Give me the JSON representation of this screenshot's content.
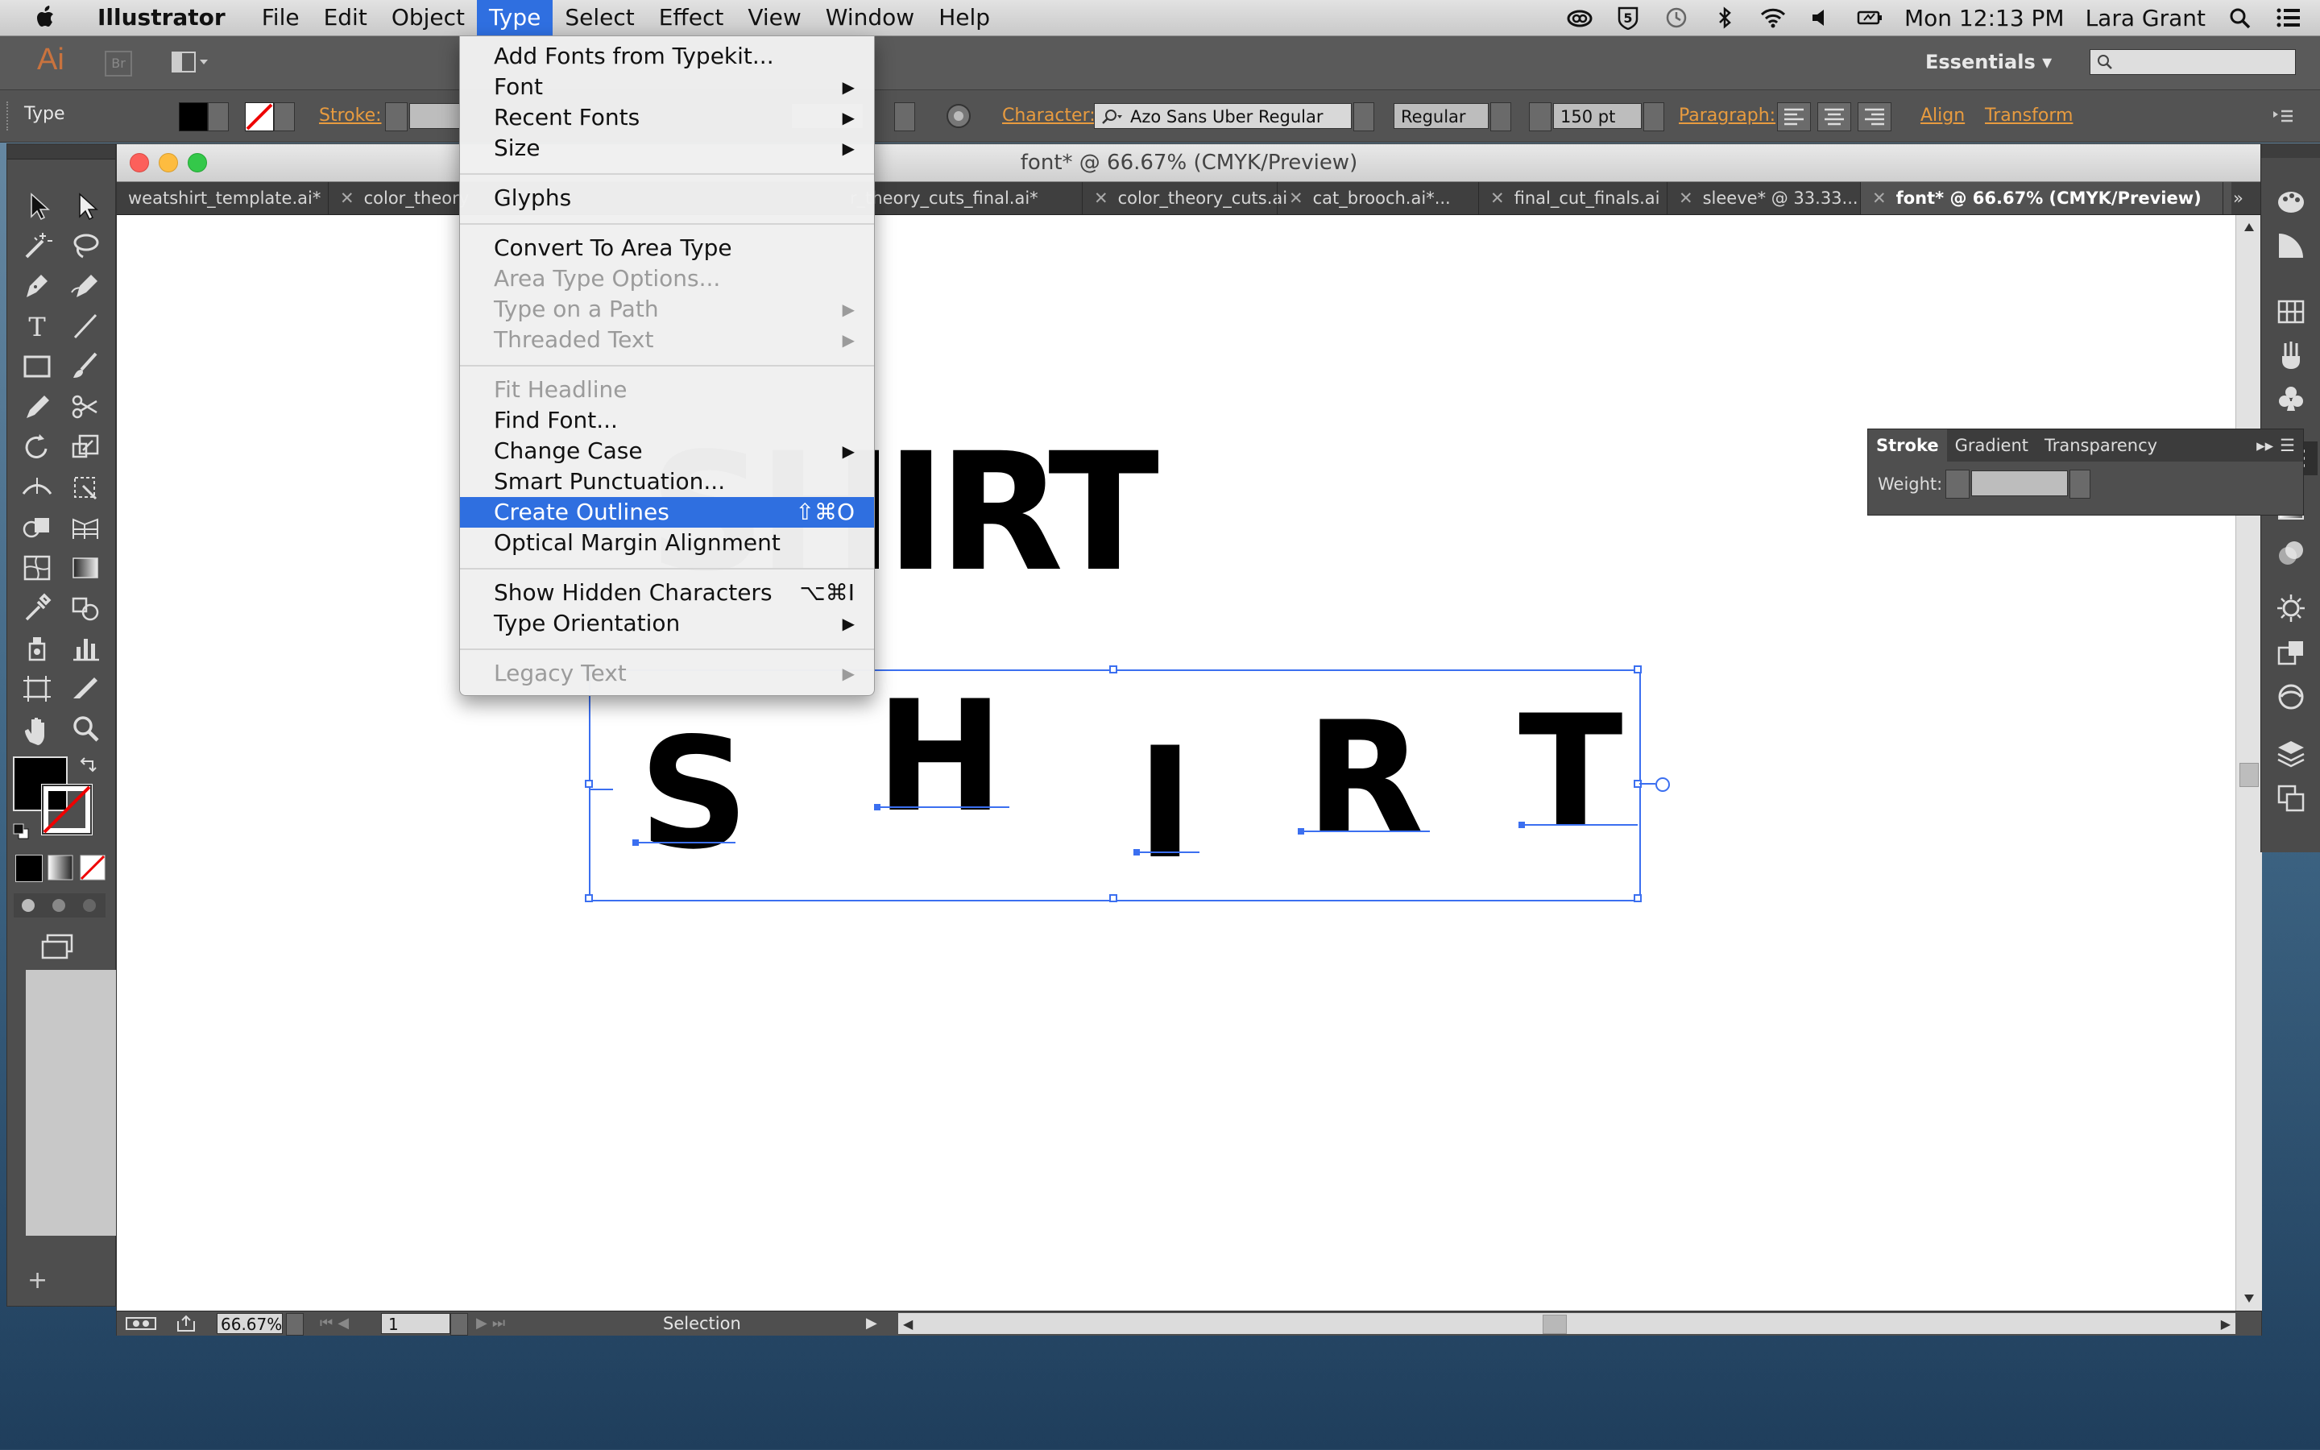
{
  "menubar": {
    "app": "Illustrator",
    "menus": [
      "File",
      "Edit",
      "Object",
      "Type",
      "Select",
      "Effect",
      "View",
      "Window",
      "Help"
    ],
    "active_menu": "Type",
    "clock": "Mon 12:13 PM",
    "user": "Lara Grant"
  },
  "appbar": {
    "logo": "Ai",
    "bridge": "Br",
    "workspace": "Essentials",
    "workspace_arrow": "▾"
  },
  "controlbar": {
    "tool_label": "Type",
    "stroke_label": "Stroke:",
    "character_label": "Character:",
    "font_family": "Azo Sans Uber Regular",
    "font_style": "Regular",
    "font_size": "150 pt",
    "paragraph_label": "Paragraph:",
    "align_label": "Align",
    "transform_label": "Transform"
  },
  "document": {
    "title": "font* @ 66.67% (CMYK/Preview)",
    "tabs": [
      "weatshirt_template.ai*",
      "color_theory",
      "r_theory_cuts_final.ai*",
      "color_theory_cuts.ai",
      "cat_brooch.ai*...",
      "final_cut_finals.ai",
      "sleeve* @ 33.33...",
      "font* @ 66.67% (CMYK/Preview)"
    ],
    "active_tab_index": 7,
    "art_top": "SHIRT",
    "art_letters": [
      "S",
      "H",
      "I",
      "R",
      "T"
    ]
  },
  "statusbar": {
    "zoom": "66.67%",
    "artboard": "1",
    "mode": "Selection"
  },
  "stroke_panel": {
    "tabs": [
      "Stroke",
      "Gradient",
      "Transparency"
    ],
    "active_tab": "Stroke",
    "weight_label": "Weight:"
  },
  "type_menu": {
    "items": [
      {
        "label": "Add Fonts from Typekit...",
        "enabled": true
      },
      {
        "label": "Font",
        "enabled": true,
        "submenu": true
      },
      {
        "label": "Recent Fonts",
        "enabled": true,
        "submenu": true
      },
      {
        "label": "Size",
        "enabled": true,
        "submenu": true
      },
      {
        "label": "Glyphs",
        "enabled": true
      },
      {
        "label": "Convert To Area Type",
        "enabled": true
      },
      {
        "label": "Area Type Options...",
        "enabled": false
      },
      {
        "label": "Type on a Path",
        "enabled": false,
        "submenu": true
      },
      {
        "label": "Threaded Text",
        "enabled": false,
        "submenu": true
      },
      {
        "label": "Fit Headline",
        "enabled": false
      },
      {
        "label": "Find Font...",
        "enabled": true
      },
      {
        "label": "Change Case",
        "enabled": true,
        "submenu": true
      },
      {
        "label": "Smart Punctuation...",
        "enabled": true
      },
      {
        "label": "Create Outlines",
        "enabled": true,
        "shortcut": "⇧⌘O",
        "highlighted": true
      },
      {
        "label": "Optical Margin Alignment",
        "enabled": true
      },
      {
        "label": "Show Hidden Characters",
        "enabled": true,
        "shortcut": "⌥⌘I"
      },
      {
        "label": "Type Orientation",
        "enabled": true,
        "submenu": true
      },
      {
        "label": "Legacy Text",
        "enabled": false,
        "submenu": true
      }
    ]
  },
  "colors": {
    "highlight": "#2f6fe0",
    "selection": "#3b6ff0",
    "accent_orange": "#e89b3f"
  }
}
